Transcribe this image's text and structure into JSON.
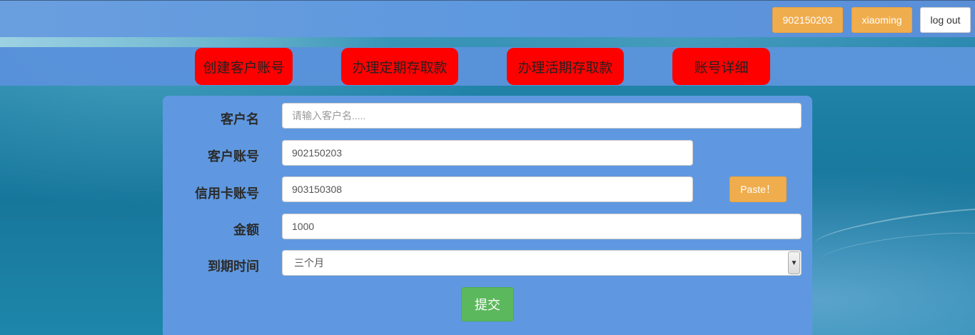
{
  "header": {
    "account_button": "902150203",
    "user_button": "xiaoming",
    "logout_button": "log out"
  },
  "nav": {
    "items": [
      {
        "label": "创建客户账号"
      },
      {
        "label": "办理定期存取款"
      },
      {
        "label": "办理活期存取款"
      },
      {
        "label": "账号详细"
      }
    ],
    "button_color": "#ff0000"
  },
  "form": {
    "customer_name": {
      "label": "客户名",
      "value": "",
      "placeholder": "请输入客户名....."
    },
    "customer_account": {
      "label": "客户账号",
      "value": "902150203"
    },
    "credit_card": {
      "label": "信用卡账号",
      "value": "903150308"
    },
    "amount": {
      "label": "金额",
      "value": "1000"
    },
    "term": {
      "label": "到期时间",
      "selected": "三个月"
    },
    "paste_button": "Paste！",
    "submit_button": "提交"
  },
  "colors": {
    "warning": "#f0ad4e",
    "success": "#5cb85c",
    "panel": "#5f98e0"
  }
}
